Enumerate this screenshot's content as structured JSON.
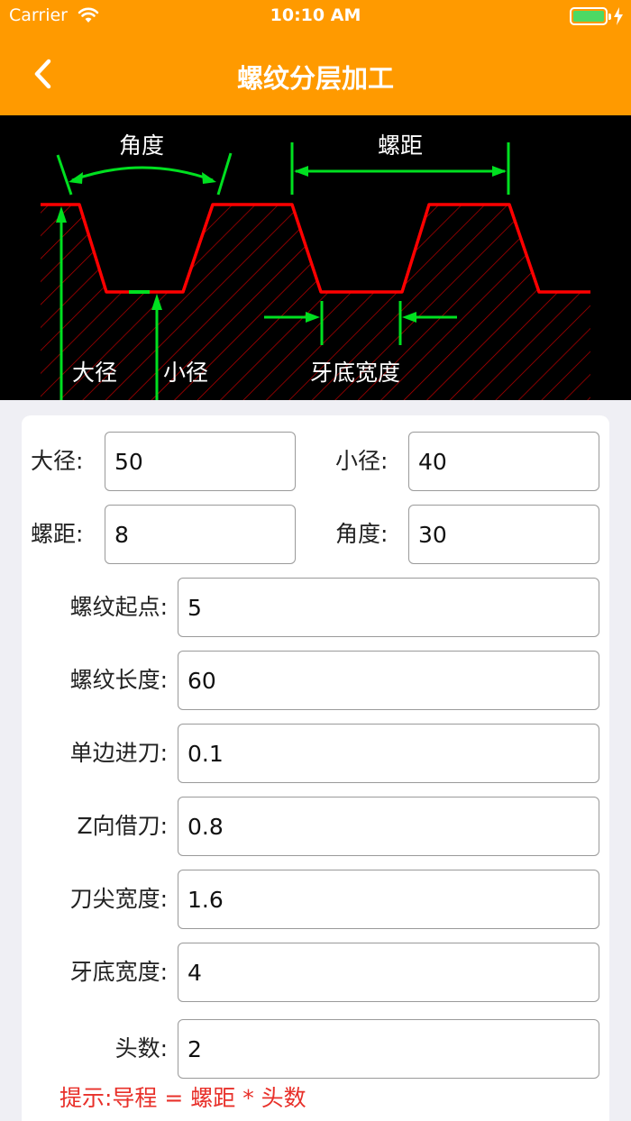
{
  "status_bar": {
    "carrier": "Carrier",
    "time": "10:10 AM",
    "battery_color": "#4cd964"
  },
  "nav": {
    "title": "螺纹分层加工",
    "back_icon": "chevron-left-icon",
    "bg_color": "#ff9a00"
  },
  "diagram": {
    "label_angle": "角度",
    "label_pitch": "螺距",
    "label_major": "大径",
    "label_minor": "小径",
    "label_root_width": "牙底宽度",
    "profile_color": "#ff0000",
    "dimension_color": "#00e020"
  },
  "form": {
    "major_diameter": {
      "label": "大径:",
      "value": "50"
    },
    "minor_diameter": {
      "label": "小径:",
      "value": "40"
    },
    "pitch": {
      "label": "螺距:",
      "value": "8"
    },
    "angle": {
      "label": "角度:",
      "value": "30"
    },
    "thread_start": {
      "label": "螺纹起点:",
      "value": "5"
    },
    "thread_length": {
      "label": "螺纹长度:",
      "value": "60"
    },
    "single_feed": {
      "label": "单边进刀:",
      "value": "0.1"
    },
    "z_offset": {
      "label": "Z向借刀:",
      "value": "0.8"
    },
    "tip_width": {
      "label": "刀尖宽度:",
      "value": "1.6"
    },
    "root_width": {
      "label": "牙底宽度:",
      "value": "4"
    },
    "starts": {
      "label": "头数:",
      "value": "2"
    }
  },
  "hint": "提示:导程 = 螺距 * 头数"
}
